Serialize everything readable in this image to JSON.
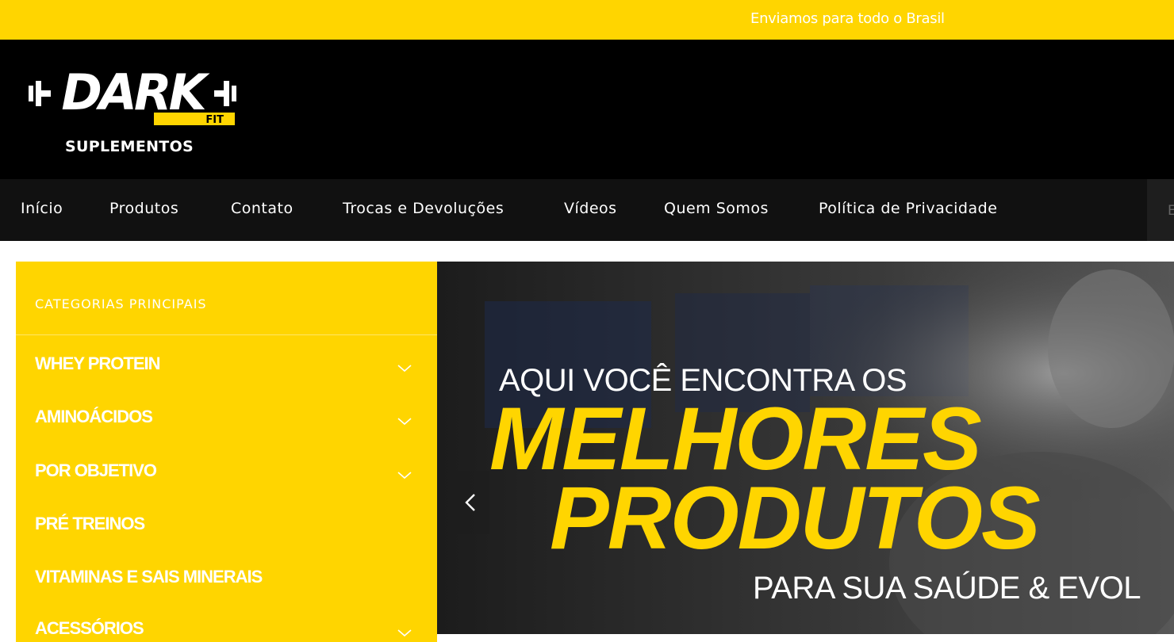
{
  "topbar": {
    "message": "Enviamos para todo o Brasil"
  },
  "brand": {
    "logo_text": "DARK",
    "logo_badge": "FIT",
    "subtitle": "SUPLEMENTOS"
  },
  "nav": {
    "items": [
      "Início",
      "Produtos",
      "Contato",
      "Trocas e Devoluções",
      "Vídeos",
      "Quem Somos",
      "Política de Privacidade"
    ],
    "search_placeholder_visible": "E"
  },
  "sidebar": {
    "title": "CATEGORIAS PRINCIPAIS",
    "categories": [
      {
        "label": "WHEY PROTEIN",
        "expandable": true
      },
      {
        "label": "AMINOÁCIDOS",
        "expandable": true
      },
      {
        "label": "POR OBJETIVO",
        "expandable": true
      },
      {
        "label": "PRÉ TREINOS",
        "expandable": false
      },
      {
        "label": "VITAMINAS E SAIS MINERAIS",
        "expandable": false
      },
      {
        "label": "ACESSÓRIOS",
        "expandable": true
      }
    ]
  },
  "banner": {
    "line1": "AQUI VOCÊ ENCONTRA OS",
    "line2": "MELHORES",
    "line3": "PRODUTOS",
    "line4": "PARA SUA SAÚDE & EVOL"
  },
  "colors": {
    "accent": "#ffd500",
    "header_bg": "#000000",
    "nav_bg": "#111111"
  }
}
